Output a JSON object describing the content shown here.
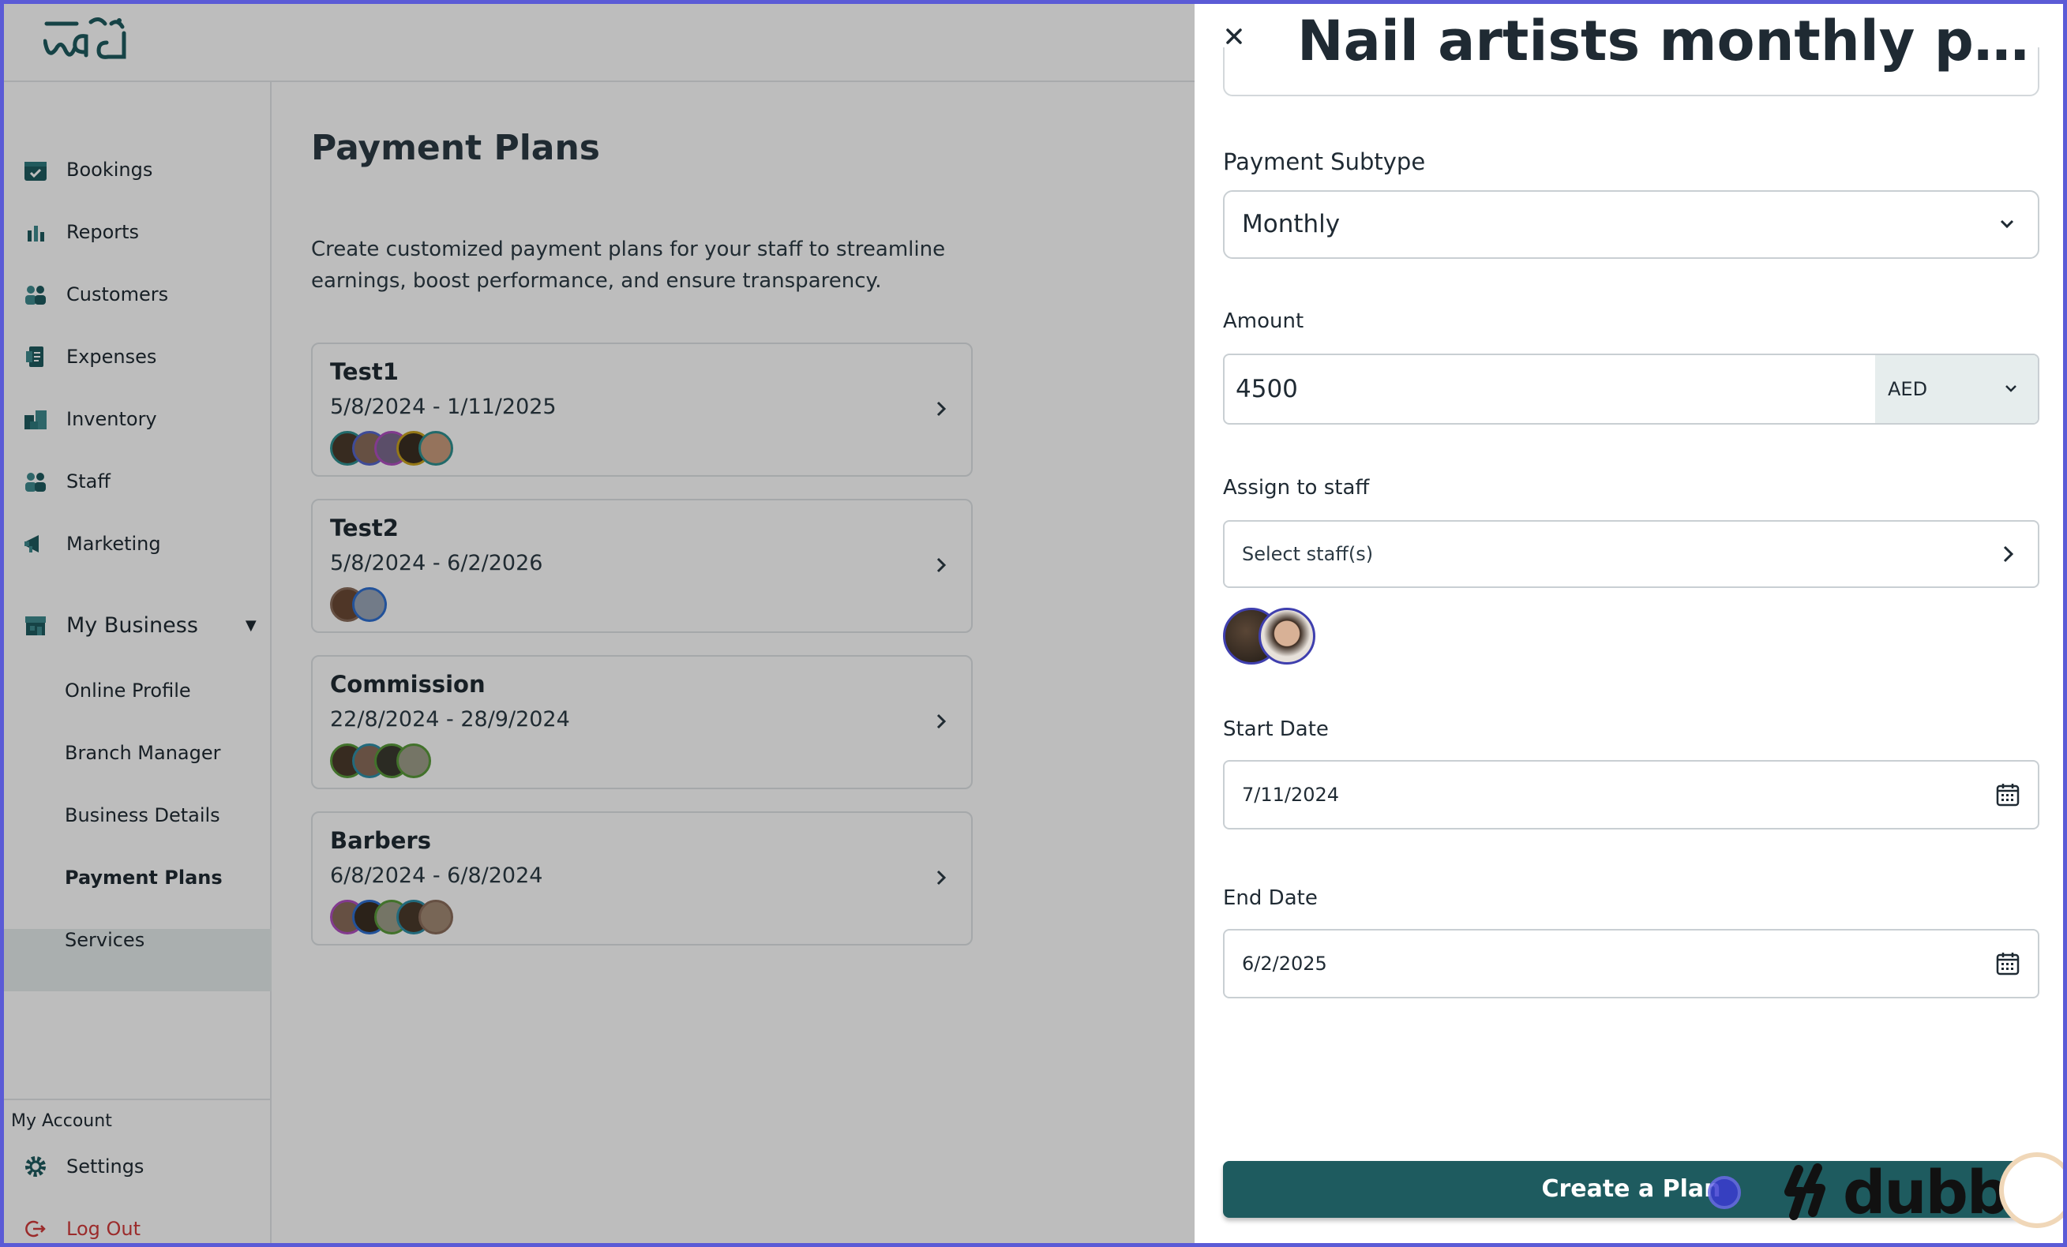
{
  "nav": {
    "items": [
      {
        "label": "Bookings",
        "icon": "calendar-check-icon"
      },
      {
        "label": "Reports",
        "icon": "bar-chart-icon"
      },
      {
        "label": "Customers",
        "icon": "users-icon"
      },
      {
        "label": "Expenses",
        "icon": "receipt-icon"
      },
      {
        "label": "Inventory",
        "icon": "boxes-icon"
      },
      {
        "label": "Staff",
        "icon": "users-icon"
      },
      {
        "label": "Marketing",
        "icon": "megaphone-icon"
      }
    ],
    "group": {
      "label": "My Business",
      "icon": "storefront-icon",
      "expanded": true
    },
    "sub_items": [
      {
        "label": "Online Profile"
      },
      {
        "label": "Branch Manager"
      },
      {
        "label": "Business Details"
      },
      {
        "label": "Payment Plans",
        "active": true
      },
      {
        "label": "Services"
      }
    ],
    "account": {
      "section_label": "My Account",
      "settings_label": "Settings",
      "logout_label": "Log Out"
    }
  },
  "main": {
    "title": "Payment Plans",
    "description": "Create customized payment plans for your staff to streamline earnings, boost performance, and ensure transparency.",
    "plans": [
      {
        "name": "Test1",
        "dates": "5/8/2024 - 1/11/2025",
        "avatar_count": 5
      },
      {
        "name": "Test2",
        "dates": "5/8/2024 - 6/2/2026",
        "avatar_count": 2
      },
      {
        "name": "Commission",
        "dates": "22/8/2024 - 28/9/2024",
        "avatar_count": 4
      },
      {
        "name": "Barbers",
        "dates": "6/8/2024 - 6/8/2024",
        "avatar_count": 5
      }
    ]
  },
  "panel": {
    "title": "Nail artists monthly payment",
    "subtype_label": "Payment Subtype",
    "subtype_value": "Monthly",
    "amount_label": "Amount",
    "amount_value": "4500",
    "currency": "AED",
    "assign_label": "Assign to staff",
    "assign_placeholder": "Select staff(s)",
    "assigned_staff_count": 2,
    "start_label": "Start Date",
    "start_value": "7/11/2024",
    "end_label": "End Date",
    "end_value": "6/2/2025",
    "create_button": "Create a Plan"
  },
  "watermark": "dubble",
  "colors": {
    "brand": "#1e5b5f",
    "accent": "#5b5bd6",
    "danger": "#d23b3b",
    "active_bg": "#e6ecec"
  }
}
